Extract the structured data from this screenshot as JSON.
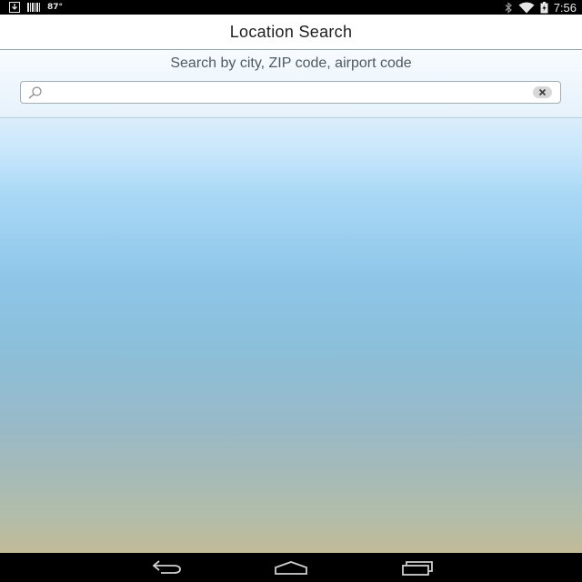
{
  "status_bar": {
    "temperature": "87°",
    "time": "7:56",
    "icons": [
      "download-icon",
      "barcode-icon",
      "bluetooth-icon",
      "wifi-icon",
      "battery-icon"
    ]
  },
  "header": {
    "title": "Location Search"
  },
  "search": {
    "hint": "Search by city, ZIP code, airport code",
    "value": "",
    "placeholder": ""
  },
  "nav_bar": {
    "icons": [
      "back-icon",
      "home-icon",
      "recent-apps-icon"
    ]
  },
  "colors": {
    "status_bar_bg": "#000000",
    "title_bg": "#ffffff",
    "sky_top": "#c9e7fb",
    "sky_mid": "#8fc6e8",
    "sky_bottom": "#c2bb98"
  }
}
